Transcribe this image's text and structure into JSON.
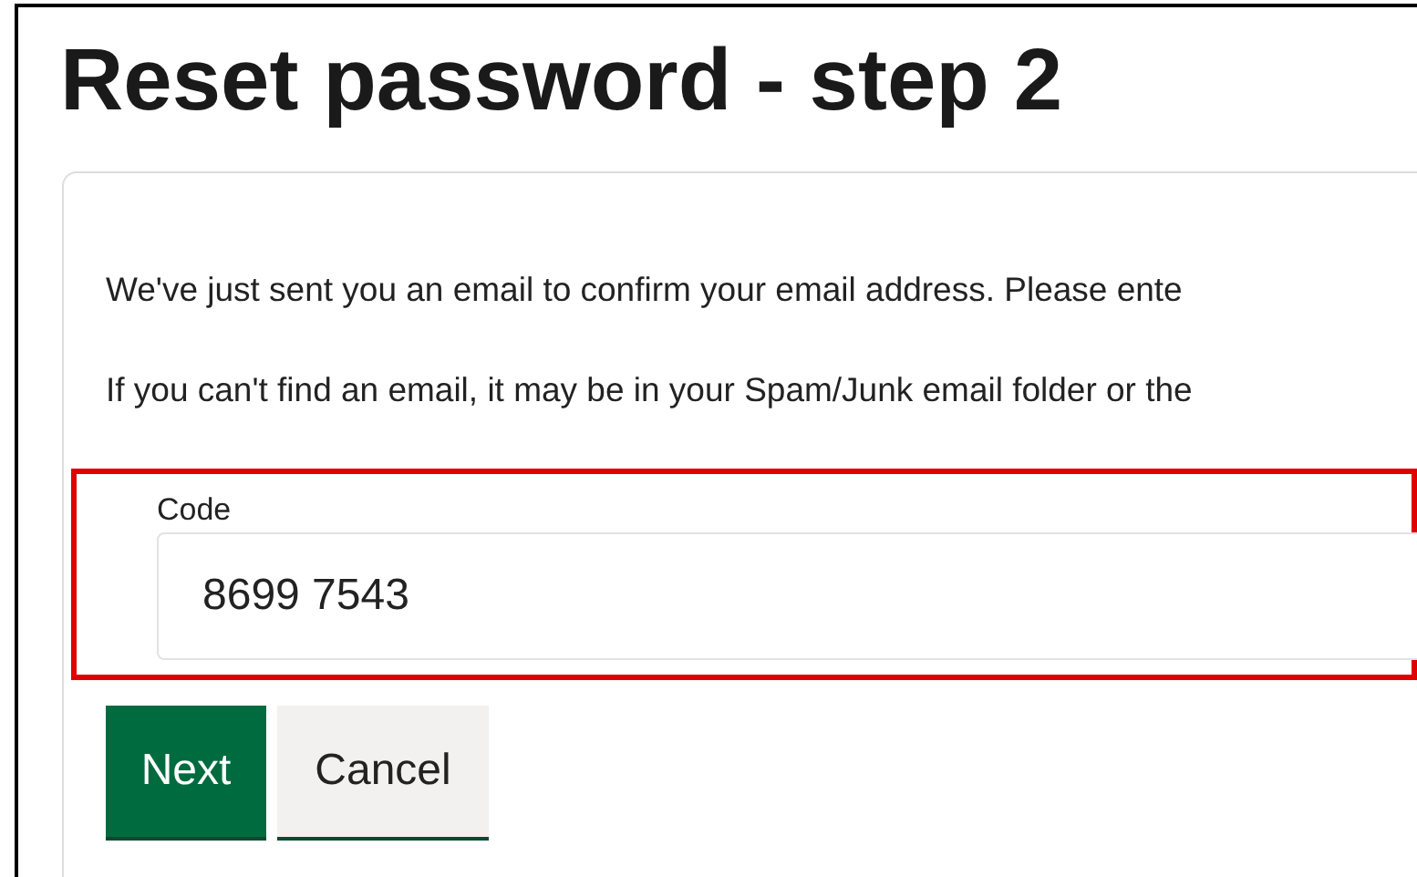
{
  "heading": "Reset password - step 2",
  "paragraphs": [
    "We've just sent you an email to confirm your email address. Please ente",
    "If you can't find an email, it may be in your Spam/Junk email folder or the"
  ],
  "code_field": {
    "label": "Code",
    "value": "8699 7543",
    "highlighted": true
  },
  "buttons": [
    {
      "label": "Next",
      "kind": "primary"
    },
    {
      "label": "Cancel",
      "kind": "secondary"
    }
  ]
}
